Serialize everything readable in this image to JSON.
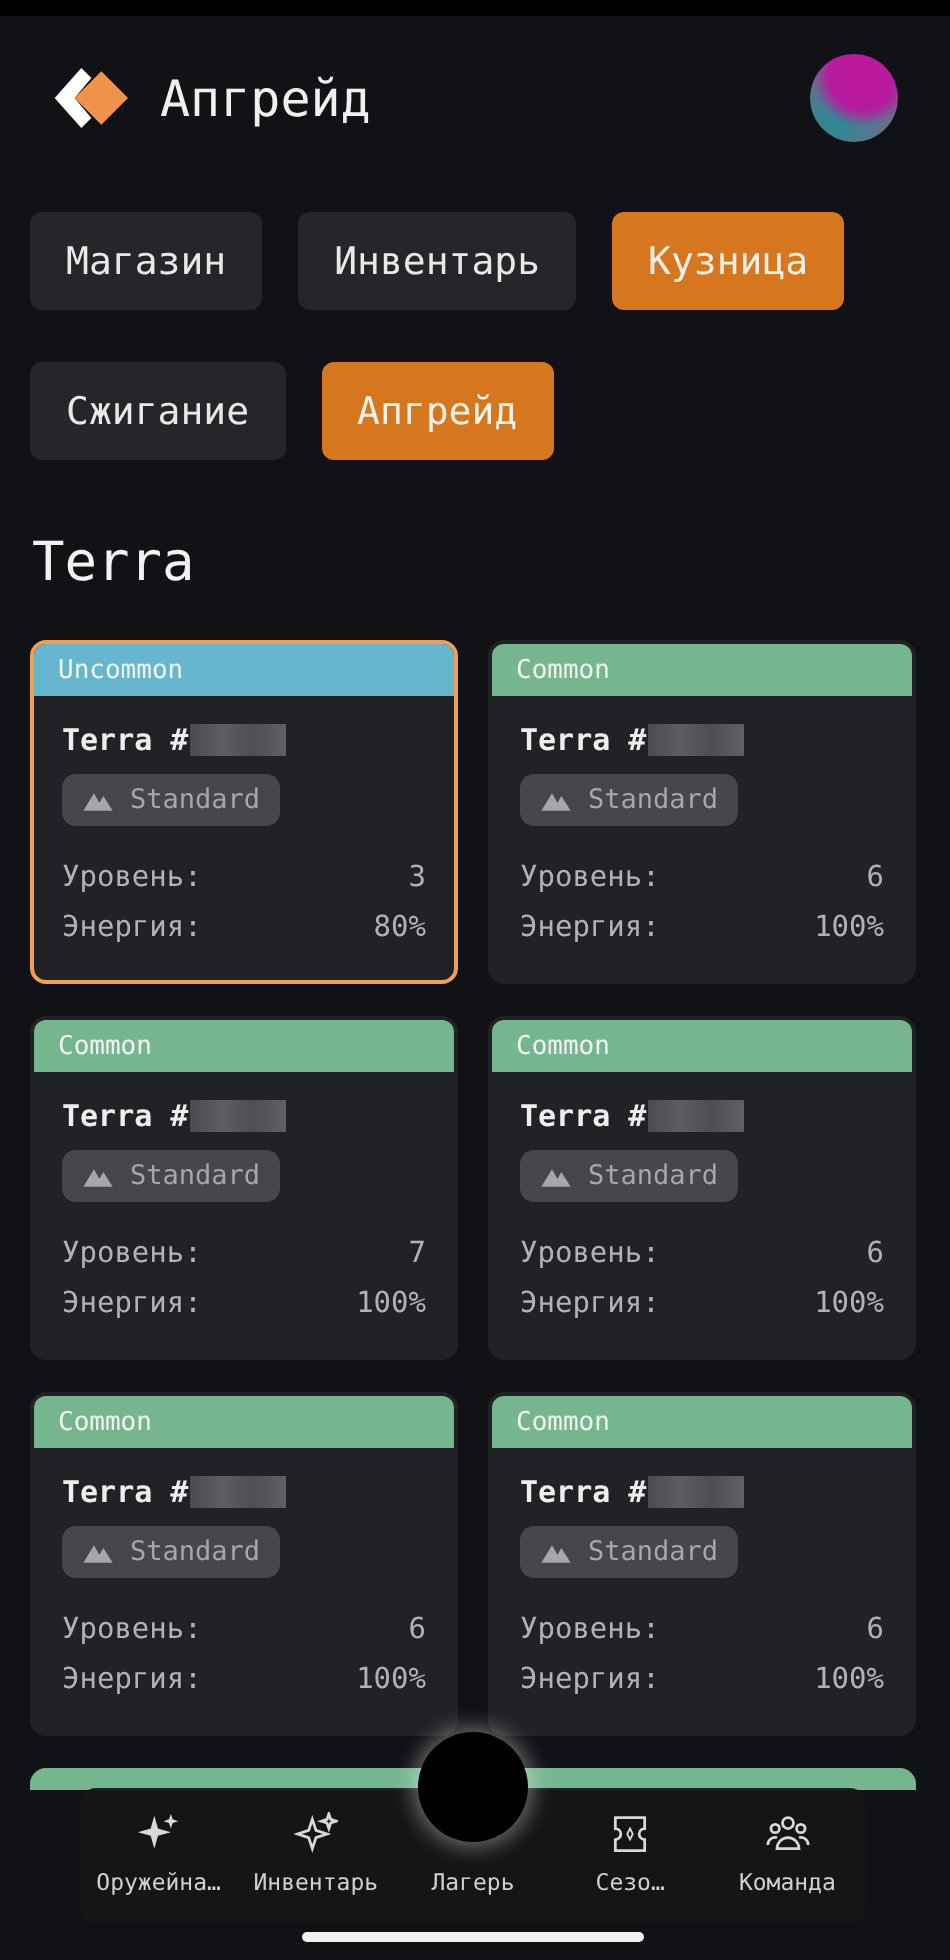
{
  "header": {
    "title": "Апгрейд"
  },
  "tabs": [
    {
      "label": "Магазин",
      "selected": false
    },
    {
      "label": "Инвентарь",
      "selected": false
    },
    {
      "label": "Кузница",
      "selected": true
    },
    {
      "label": "Сжигание",
      "selected": false
    },
    {
      "label": "Апгрейд",
      "selected": true
    }
  ],
  "section_title": "Terra",
  "cards": [
    {
      "rarity": "Uncommon",
      "color": "#67b6d0",
      "name": "Terra #",
      "badge": "Standard",
      "level_label": "Уровень:",
      "level": "3",
      "energy_label": "Энергия:",
      "energy": "80%",
      "selected": true
    },
    {
      "rarity": "Common",
      "color": "#76b68e",
      "name": "Terra #",
      "badge": "Standard",
      "level_label": "Уровень:",
      "level": "6",
      "energy_label": "Энергия:",
      "energy": "100%",
      "selected": false
    },
    {
      "rarity": "Common",
      "color": "#76b68e",
      "name": "Terra #",
      "badge": "Standard",
      "level_label": "Уровень:",
      "level": "7",
      "energy_label": "Энергия:",
      "energy": "100%",
      "selected": false
    },
    {
      "rarity": "Common",
      "color": "#76b68e",
      "name": "Terra #",
      "badge": "Standard",
      "level_label": "Уровень:",
      "level": "6",
      "energy_label": "Энергия:",
      "energy": "100%",
      "selected": false
    },
    {
      "rarity": "Common",
      "color": "#76b68e",
      "name": "Terra #",
      "badge": "Standard",
      "level_label": "Уровень:",
      "level": "6",
      "energy_label": "Энергия:",
      "energy": "100%",
      "selected": false
    },
    {
      "rarity": "Common",
      "color": "#76b68e",
      "name": "Terra #",
      "badge": "Standard",
      "level_label": "Уровень:",
      "level": "6",
      "energy_label": "Энергия:",
      "energy": "100%",
      "selected": false
    }
  ],
  "covered_cards": [
    {
      "color": "#76b68e"
    },
    {
      "color": "#76b68e"
    }
  ],
  "bottom_nav": [
    {
      "label": "Оружейна…",
      "kind": "sparkles"
    },
    {
      "label": "Инвентарь",
      "kind": "outline"
    },
    {
      "label": "Лагерь",
      "kind": "center"
    },
    {
      "label": "Сезо…",
      "kind": "ticket"
    },
    {
      "label": "Команда",
      "kind": "people"
    }
  ]
}
